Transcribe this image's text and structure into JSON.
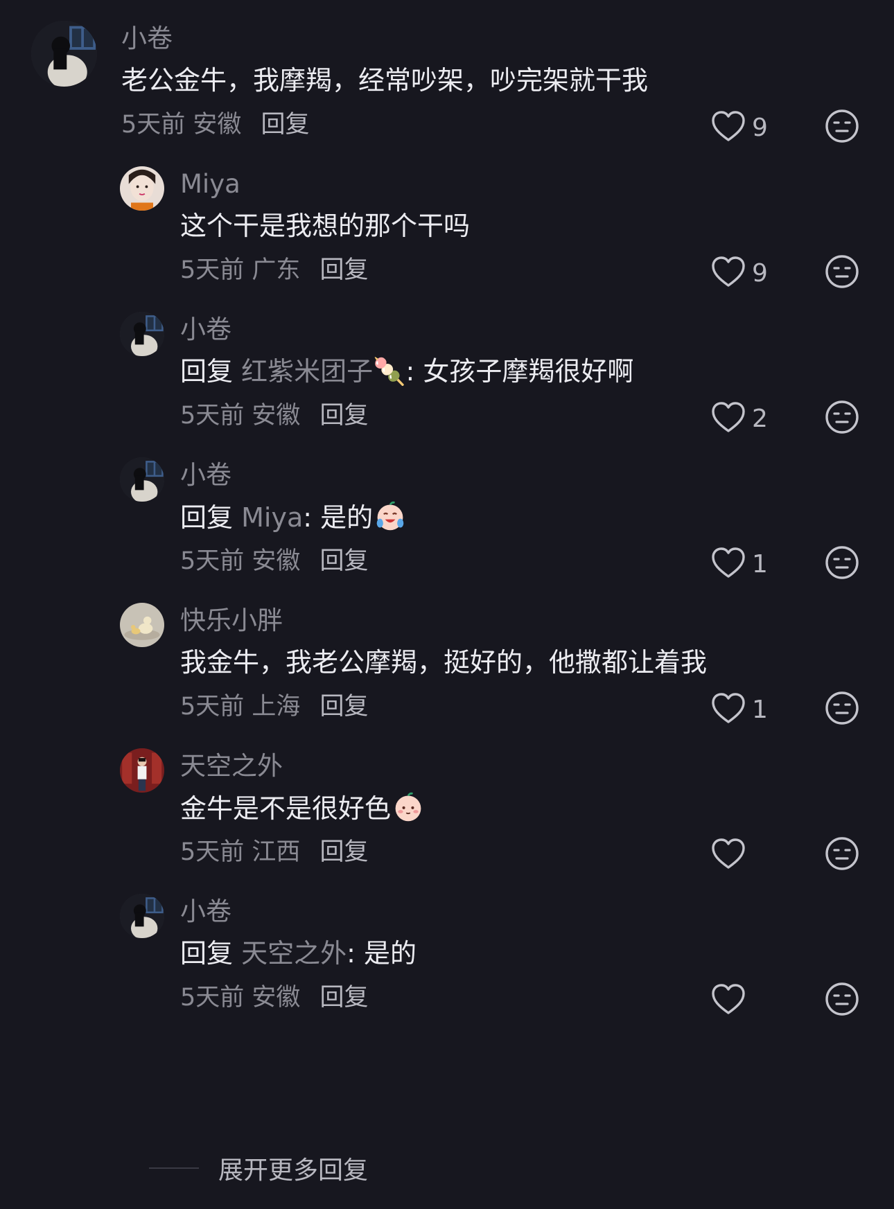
{
  "comments": [
    {
      "username": "小卷",
      "reply_prefix": "",
      "mention": "",
      "text": "老公金牛，我摩羯，经常吵架，吵完架就干我",
      "emoji": "",
      "time": "5天前",
      "location": "安徽",
      "reply_label": "回复",
      "likes": "9",
      "avatar": "avatar-dark-girl"
    },
    {
      "username": "Miya",
      "reply_prefix": "",
      "mention": "",
      "text": "这个干是我想的那个干吗",
      "emoji": "",
      "time": "5天前",
      "location": "广东",
      "reply_label": "回复",
      "likes": "9",
      "avatar": "avatar-girl-face"
    },
    {
      "username": "小卷",
      "reply_prefix": "回复",
      "mention": "红紫米团子🍡",
      "text": ": 女孩子摩羯很好啊",
      "emoji": "",
      "time": "5天前",
      "location": "安徽",
      "reply_label": "回复",
      "likes": "2",
      "avatar": "avatar-dark-girl"
    },
    {
      "username": "小卷",
      "reply_prefix": "回复",
      "mention": "Miya",
      "text": ": 是的",
      "emoji": "crying-laughing-face",
      "time": "5天前",
      "location": "安徽",
      "reply_label": "回复",
      "likes": "1",
      "avatar": "avatar-dark-girl"
    },
    {
      "username": "快乐小胖",
      "reply_prefix": "",
      "mention": "",
      "text": "我金牛，我老公摩羯，挺好的，他撒都让着我",
      "emoji": "",
      "time": "5天前",
      "location": "上海",
      "reply_label": "回复",
      "likes": "1",
      "avatar": "avatar-duck"
    },
    {
      "username": "天空之外",
      "reply_prefix": "",
      "mention": "",
      "text": "金牛是不是很好色",
      "emoji": "blushing-face",
      "time": "5天前",
      "location": "江西",
      "reply_label": "回复",
      "likes": "",
      "avatar": "avatar-red-room"
    },
    {
      "username": "小卷",
      "reply_prefix": "回复",
      "mention": "天空之外",
      "text": ": 是的",
      "emoji": "",
      "time": "5天前",
      "location": "安徽",
      "reply_label": "回复",
      "likes": "",
      "avatar": "avatar-dark-girl"
    }
  ],
  "expand_label": "展开更多回复",
  "colors": {
    "background": "#17171f",
    "primary_text": "#ececf1",
    "secondary_text": "#8a8a93"
  },
  "icons": {
    "like": "heart-outline-icon",
    "dislike": "meh-face-icon"
  }
}
